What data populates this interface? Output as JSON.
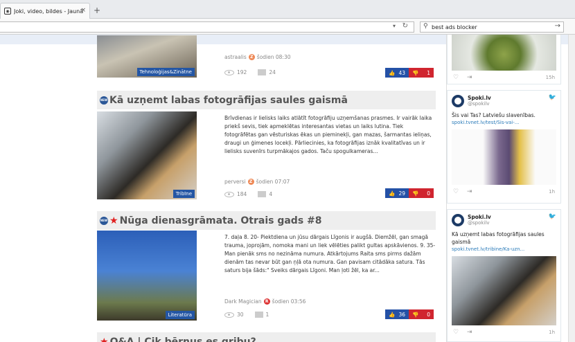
{
  "browser": {
    "tab_title": "Joki, video, bildes - Jaunākais",
    "tab_close": "×",
    "new_tab": "+",
    "url_value": "",
    "search_value": "best ads blocker"
  },
  "articles": [
    {
      "title": "",
      "category": "Tehnoloģijas&Zinātne",
      "author": "astraalis",
      "time": "šodien 08:30",
      "views": "192",
      "comments": "24",
      "likes": "43",
      "dislikes": "1"
    },
    {
      "title": "Kā uzņemt labas fotogrāfijas saules gaismā",
      "category": "Tribīne",
      "text": "Brīvdienas ir lielisks laiks atlātīt fotogrāfiju uzņemšanas prasmes. Ir vairāk laika priekš sevis, tiek apmeklētas interesantas vietas un laiks lutina. Tiek fotogrāfētas gan vēsturiskas ēkas un pieminekļi, gan mazas, šarmantas ieliņas, draugi un ģimenes locekļi. Pārliecinies, ka fotogrāfijas iznāk kvalitatīvas un ir lielisks suvenīrs turpmākajos gados. Taču spogulkameras...",
      "author": "perversi",
      "time": "šodien 07:07",
      "views": "184",
      "comments": "4",
      "likes": "29",
      "dislikes": "0"
    },
    {
      "title": "Nūga dienasgrāmata. Otrais gads #8",
      "category": "Literatūra",
      "text": "7. daļa 8. 20- Piektdiena un jūsu dārgais Līgonis ir augšā. Diemžēl, gan smagā trauma, joprojām, nomoka mani un liek vēlēties palikt gultas apskāvienos. 9. 35- Man pienāk sms no nezināma numura. Atkārtojums Raita sms pirms dažām dienām tas nevar būt gan ņļā ota numura. Gan pavisam citādāka satura. Tās saturs bija šāds:\" Sveiks dārgais Līgoni. Man ļoti žēl, ka ar...",
      "author": "Dark Magician",
      "time": "šodien 03:56",
      "views": "30",
      "comments": "1",
      "likes": "36",
      "dislikes": "0"
    },
    {
      "title": "Q&A | Cik bērnus es gribu?"
    }
  ],
  "sidebar": {
    "tweets": [
      {
        "time": "15h"
      },
      {
        "name": "Spoki.lv",
        "handle": "@spokilv",
        "text": "Šis vai Tas? Latviešu slavenības.",
        "link": "spoki.tvnet.lv/test/Sis-vai-...",
        "time": "1h"
      },
      {
        "name": "Spoki.lv",
        "handle": "@spokilv",
        "text": "Kā uzņemt labas fotogrāfijas saules gaismā",
        "link": "spoki.tvnet.lv/tribine/Ka-uzn...",
        "time": "1h"
      }
    ]
  },
  "colors": {
    "like": "#2451a6",
    "dislike": "#d0252f",
    "category": "#2456a4",
    "link": "#2b7bb9"
  }
}
